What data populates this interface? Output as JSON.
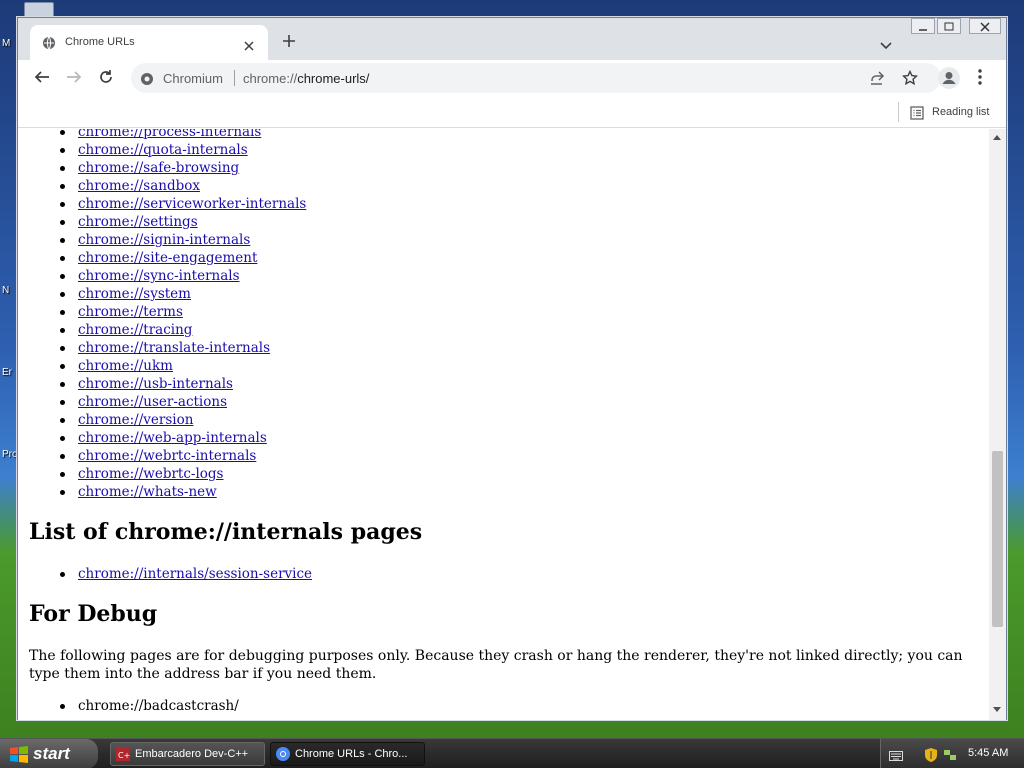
{
  "desktop": {
    "labels": [
      "M",
      "N",
      "Er",
      "Pro"
    ]
  },
  "browser": {
    "tab": {
      "title": "Chrome URLs",
      "icon": "globe-icon"
    },
    "window_controls": [
      "minimize",
      "maximize",
      "close"
    ],
    "toolbar": {
      "back": "back-arrow-icon",
      "forward": "forward-arrow-icon",
      "reload": "reload-icon",
      "site_label": "Chromium",
      "url_scheme": "chrome://",
      "url_path": "chrome-urls/",
      "share": "share-icon",
      "bookmark": "star-icon",
      "profile": "profile-icon",
      "menu": "kebab-menu-icon"
    },
    "bookmark_bar": {
      "reading_list": "Reading list"
    }
  },
  "page": {
    "links": [
      "chrome://process-internals",
      "chrome://quota-internals",
      "chrome://safe-browsing",
      "chrome://sandbox",
      "chrome://serviceworker-internals",
      "chrome://settings",
      "chrome://signin-internals",
      "chrome://site-engagement",
      "chrome://sync-internals",
      "chrome://system",
      "chrome://terms",
      "chrome://tracing",
      "chrome://translate-internals",
      "chrome://ukm",
      "chrome://usb-internals",
      "chrome://user-actions",
      "chrome://version",
      "chrome://web-app-internals",
      "chrome://webrtc-internals",
      "chrome://webrtc-logs",
      "chrome://whats-new"
    ],
    "internals_heading": "List of chrome://internals pages",
    "internals_links": [
      "chrome://internals/session-service"
    ],
    "debug_heading": "For Debug",
    "debug_text": "The following pages are for debugging purposes only. Because they crash or hang the renderer, they're not linked directly; you can type them into the address bar if you need them.",
    "debug_items": [
      "chrome://badcastcrash/"
    ]
  },
  "taskbar": {
    "start_label": "start",
    "tasks": [
      {
        "label": "Embarcadero Dev-C++",
        "active": false
      },
      {
        "label": "Chrome URLs - Chro...",
        "active": true
      }
    ],
    "clock": "5:45 AM"
  },
  "colors": {
    "link": "#1a0dab",
    "tab_strip": "#dee1e6",
    "omnibox": "#f1f3f4"
  }
}
